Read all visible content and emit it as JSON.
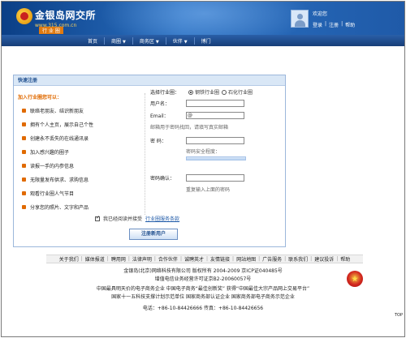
{
  "header": {
    "logo_name": "金银岛网交所",
    "logo_url": "www.315.com.cn",
    "logo_sub": "行 业 圈",
    "welcome": "欢迎您",
    "login": "登录",
    "register": "注册",
    "help": "帮助"
  },
  "nav": {
    "items": [
      {
        "label": "首页",
        "caret": false
      },
      {
        "label": "商圈",
        "caret": true
      },
      {
        "label": "商务区",
        "caret": true
      },
      {
        "label": "伙伴",
        "caret": true
      },
      {
        "label": "博门",
        "caret": false
      }
    ]
  },
  "panel": {
    "title": "快速注册",
    "benefits_title": "加入行业圈您可以：",
    "benefits": [
      "联络老朋友、结识新朋友",
      "拥有个人主页，展示自己个性",
      "创建永不丢失的在线通讯录",
      "加入感兴趣的圈子",
      "读报一手的内参信息",
      "无限量发布供求、求购信息",
      "观看行业圈人气节目",
      "分享您的照片、文字和产品"
    ],
    "form": {
      "industry_label": "选择行业圈：",
      "radio_steel": "钢铁行业圈",
      "radio_petro": "石化行业圈",
      "username_label": "用户名：",
      "username_value": "",
      "email_label": "Email：",
      "email_value": "@",
      "email_hint": "邮箱用于密码找回，请填写真实邮箱",
      "password_label": "密  码：",
      "password_value": "",
      "strength_label": "密码安全程度：",
      "confirm_label": "密码确认：",
      "confirm_value": "",
      "confirm_hint": "重复输入上面的密码"
    },
    "agree_text": "我已经阅读并接受",
    "agree_link": "行业圈服务条款",
    "submit_label": "注册新用户"
  },
  "footer": {
    "links": [
      "关于我们",
      "媒体报道",
      "聘用网",
      "法律声明",
      "合作伙伴",
      "诚聘英才",
      "友情链接",
      "网站地图",
      "广告服务",
      "联系我们",
      "建议投诉",
      "帮助"
    ],
    "line1": "金银岛(北京)网络科技有限公司 版权所有 2004-2009 京ICP证040485号",
    "line2": "增值电信业务经营许可证京B2-20060057号",
    "line3": "中国最具明天价的电子商务企业  中国电子商务“最佳创新奖”  获得“中国最佳大宗产品网上交易平台”",
    "line4": "国家十一五科技支撑计划示范单位  国家商务部认证企业  国家商务部电子商务示范企业",
    "line5": "电话：+86-10-84426666   传真：+86-10-84426656",
    "top": "TOP"
  }
}
